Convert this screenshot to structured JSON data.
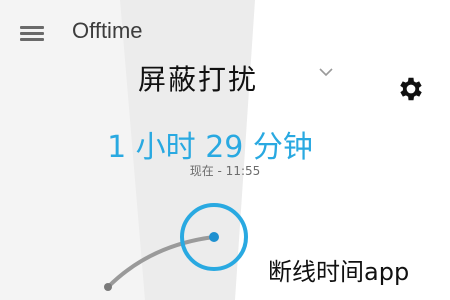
{
  "header": {
    "title": "Offtime",
    "menu_icon": "hamburger-menu-icon"
  },
  "mode_selector": {
    "value": "屏蔽打扰",
    "icon": "chevron-down-icon"
  },
  "settings": {
    "icon": "gear-icon"
  },
  "timer": {
    "duration": "1 小时 29 分钟",
    "now": "现在 - 11:55"
  },
  "caption": "断线时间app",
  "colors": {
    "accent": "#29a9e1",
    "background_shade": "#eeeeee",
    "track": "#9a9a9a"
  }
}
